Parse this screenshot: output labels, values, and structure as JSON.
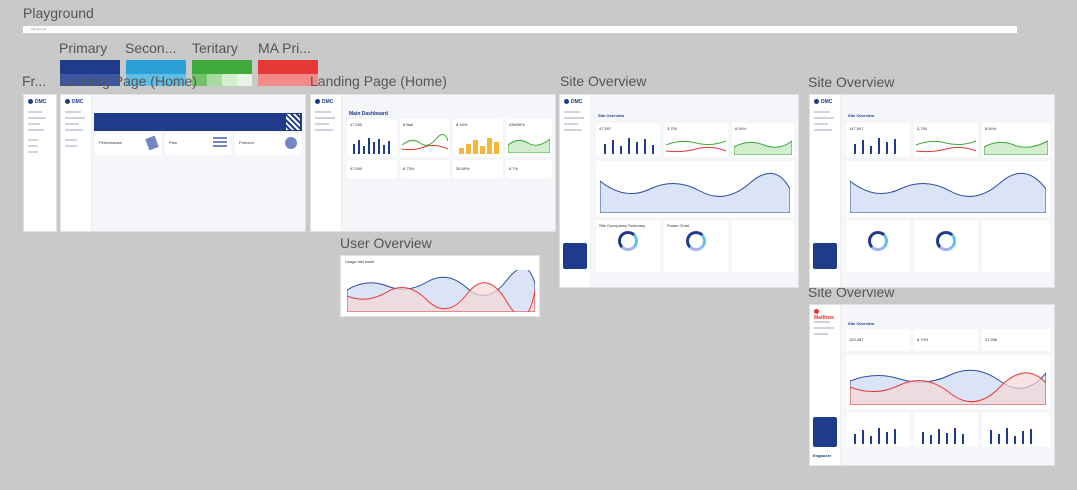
{
  "canvas": {
    "title": "Playground",
    "strip_label": "Playground"
  },
  "swatches": [
    {
      "label": "Primary",
      "colors": [
        "#1f3b8a",
        "#3a57a8",
        "#7386c4",
        "#a7b5e0"
      ]
    },
    {
      "label": "Secon...",
      "colors": [
        "#2aa0d8",
        "#5fbde6",
        "#94d3ef",
        "#c8e8f6"
      ]
    },
    {
      "label": "Teritary",
      "colors": [
        "#3fa93a",
        "#72c26b",
        "#a6dca0",
        "#d2eece"
      ]
    },
    {
      "label": "MA Pri...",
      "colors": [
        "#e53935",
        "#ef5350",
        "#f48a88",
        "#f9c0bf"
      ]
    }
  ],
  "frames": {
    "fr": {
      "label": "Fr..."
    },
    "landing1": {
      "label": "Landing Page (Home)",
      "brand": "DMC",
      "cards": [
        "Performance",
        "Plan",
        "Protocol"
      ]
    },
    "landing2": {
      "label": "Landing Page (Home)",
      "brand": "DMC",
      "heading": "Main Dashboard",
      "stats": [
        "47,000",
        "8 Ball",
        "8.19%",
        "438/96%",
        "47,500",
        "8.73%",
        "35.89%",
        "6.7%"
      ]
    },
    "site1": {
      "label": "Site Overview",
      "brand": "DMC",
      "heading": "Site Overview",
      "stats": [
        "47,597",
        "3,700",
        "8.54%"
      ],
      "donuts": [
        "Site Occupancy Summary",
        "Power Chart"
      ]
    },
    "site2": {
      "label": "Site Overview",
      "brand": "DMC",
      "heading": "Site Overview",
      "stats": [
        "147,597",
        "3,750",
        "8.54%"
      ]
    },
    "site3": {
      "label": "Site Overview",
      "brand": "Matthew",
      "heading": "Site Overview",
      "stats": [
        "153,387",
        "8.73%",
        "37,956"
      ],
      "footer_brand": "Engauxer"
    },
    "user": {
      "label": "User Overview",
      "title": "Usage last week"
    }
  },
  "colors": {
    "bg": "#c9c9c9",
    "primary": "#1f3b8a",
    "chart_blue": "#2a4ea3",
    "chart_red": "#e53935",
    "green": "#3fa93a",
    "orange": "#f5b73a"
  }
}
